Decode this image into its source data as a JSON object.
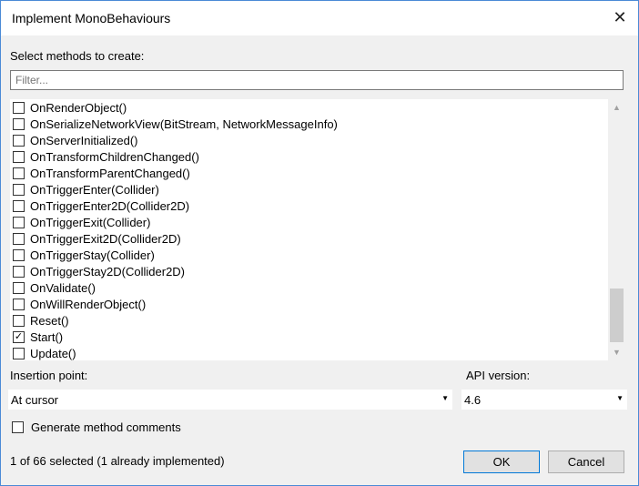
{
  "window": {
    "title": "Implement MonoBehaviours",
    "close_glyph": "✕"
  },
  "methods_section": {
    "label": "Select methods to create:",
    "filter_placeholder": "Filter...",
    "items": [
      {
        "label": "OnRenderObject()",
        "checked": false
      },
      {
        "label": "OnSerializeNetworkView(BitStream, NetworkMessageInfo)",
        "checked": false
      },
      {
        "label": "OnServerInitialized()",
        "checked": false
      },
      {
        "label": "OnTransformChildrenChanged()",
        "checked": false
      },
      {
        "label": "OnTransformParentChanged()",
        "checked": false
      },
      {
        "label": "OnTriggerEnter(Collider)",
        "checked": false
      },
      {
        "label": "OnTriggerEnter2D(Collider2D)",
        "checked": false
      },
      {
        "label": "OnTriggerExit(Collider)",
        "checked": false
      },
      {
        "label": "OnTriggerExit2D(Collider2D)",
        "checked": false
      },
      {
        "label": "OnTriggerStay(Collider)",
        "checked": false
      },
      {
        "label": "OnTriggerStay2D(Collider2D)",
        "checked": false
      },
      {
        "label": "OnValidate()",
        "checked": false
      },
      {
        "label": "OnWillRenderObject()",
        "checked": false
      },
      {
        "label": "Reset()",
        "checked": false
      },
      {
        "label": "Start()",
        "checked": true
      },
      {
        "label": "Update()",
        "checked": false
      }
    ],
    "scroll_up_glyph": "▲",
    "scroll_down_glyph": "▼"
  },
  "insertion": {
    "label": "Insertion point:",
    "selected": "At cursor"
  },
  "api": {
    "label": "API version:",
    "selected": "4.6"
  },
  "dropdown_glyph": "▼",
  "check_glyph": "✓",
  "generate_comments": {
    "label": "Generate method comments",
    "checked": false
  },
  "status_text": "1 of 66 selected (1 already implemented)",
  "buttons": {
    "ok": "OK",
    "cancel": "Cancel"
  },
  "colors": {
    "window_border": "#4a8ad6",
    "dialog_background": "#f0f0f0",
    "ok_button_border": "#0078d7"
  }
}
